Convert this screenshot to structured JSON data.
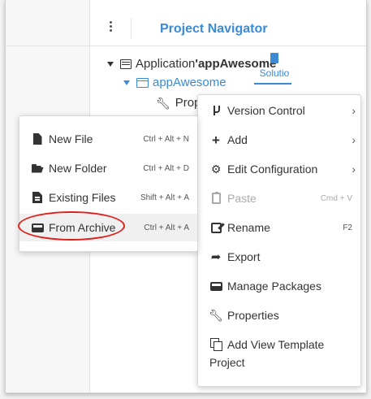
{
  "header": {
    "title": "Project Navigator"
  },
  "tree": {
    "application": {
      "prefix": "Application ",
      "name": "'appAwesome'"
    },
    "project": {
      "label": "appAwesome"
    },
    "properties": {
      "label": "Prop"
    }
  },
  "solution_tab": {
    "label": "Solutio"
  },
  "context_menu": {
    "items": [
      {
        "label": "Version Control",
        "icon": "branch-icon",
        "has_submenu": true
      },
      {
        "label": "Add",
        "icon": "plus-icon",
        "has_submenu": true
      },
      {
        "label": "Edit Configuration",
        "icon": "gears-icon",
        "has_submenu": true
      },
      {
        "label": "Paste",
        "icon": "paste-icon",
        "shortcut": "Cmd + V",
        "disabled": true
      },
      {
        "label": "Rename",
        "icon": "rename-icon",
        "shortcut": "F2"
      },
      {
        "label": "Export",
        "icon": "export-icon"
      },
      {
        "label": "Manage Packages",
        "icon": "inbox-icon"
      },
      {
        "label": "Properties",
        "icon": "wrench-icon"
      },
      {
        "label": "Add View Template",
        "label2": "Project",
        "icon": "template-icon"
      }
    ]
  },
  "add_submenu": {
    "items": [
      {
        "label": "New File",
        "icon": "file-icon",
        "shortcut": "Ctrl + Alt + N"
      },
      {
        "label": "New Folder",
        "icon": "folder-open-icon",
        "shortcut": "Ctrl + Alt + D"
      },
      {
        "label": "Existing Files",
        "icon": "files-icon",
        "shortcut": "Shift + Alt + A"
      },
      {
        "label": "From Archive",
        "icon": "archive-icon",
        "shortcut": "Ctrl + Alt + A"
      }
    ]
  },
  "colors": {
    "accent": "#3a8ad6",
    "highlight": "#e0201b"
  }
}
